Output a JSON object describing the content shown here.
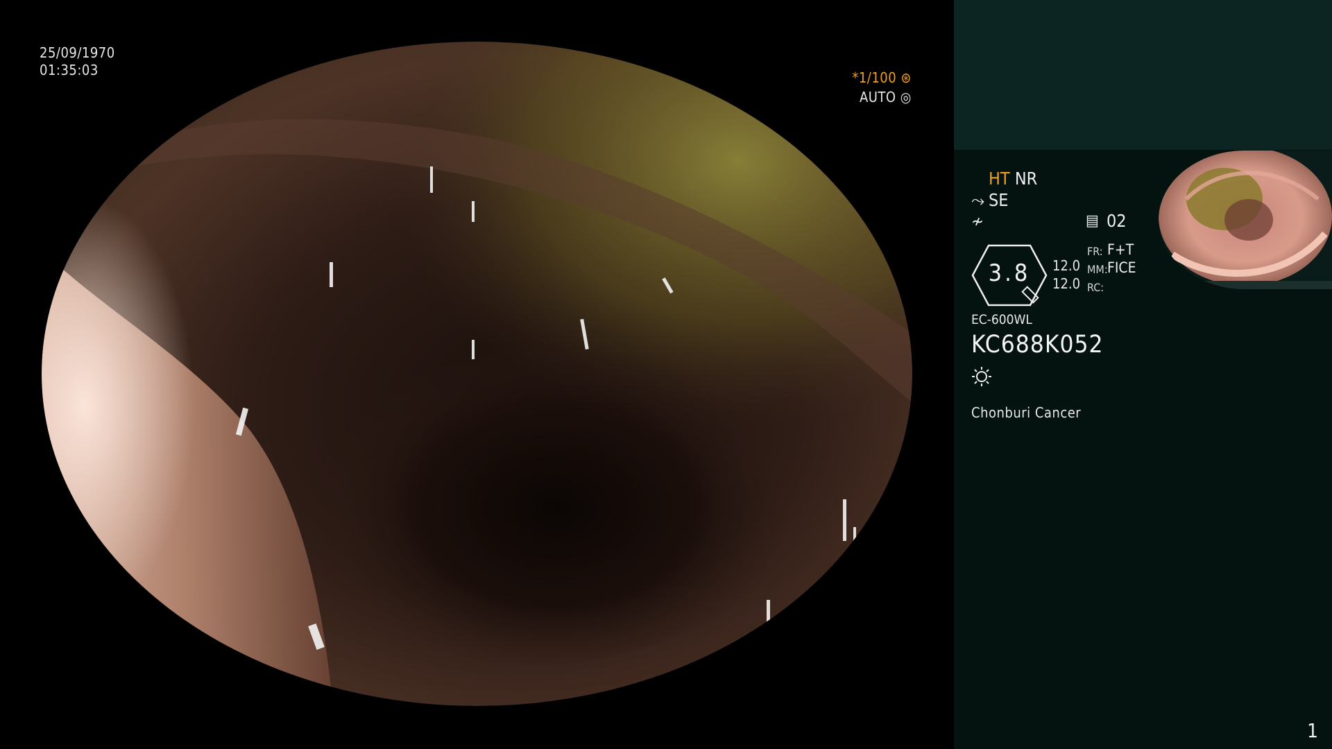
{
  "overlay": {
    "date": "25/09/1970",
    "time": "01:35:03",
    "shutter": "*1/100",
    "iris": "AUTO"
  },
  "panel": {
    "ht": "HT",
    "nr": "NR",
    "se": "SE",
    "mode_num": "02",
    "hex_value": "3.8",
    "val1": "12.0",
    "val2": "12.0",
    "labels": {
      "fr": "FR:",
      "mm": "MM:",
      "rc": "RC:"
    },
    "fr_value": "F+T",
    "mm_value": "FICE",
    "scope_model": "EC-600WL",
    "serial": "KC688K052",
    "hospital": "Chonburi Cancer",
    "page": "1"
  },
  "colors": {
    "accent_orange": "#f0a020",
    "panel_bg": "#04130f",
    "panel_top": "#0c2523"
  },
  "icons": [
    "shutter-icon",
    "iris-icon",
    "structure-icon",
    "filter-icon",
    "book-icon",
    "magnify-icon",
    "light-icon"
  ]
}
